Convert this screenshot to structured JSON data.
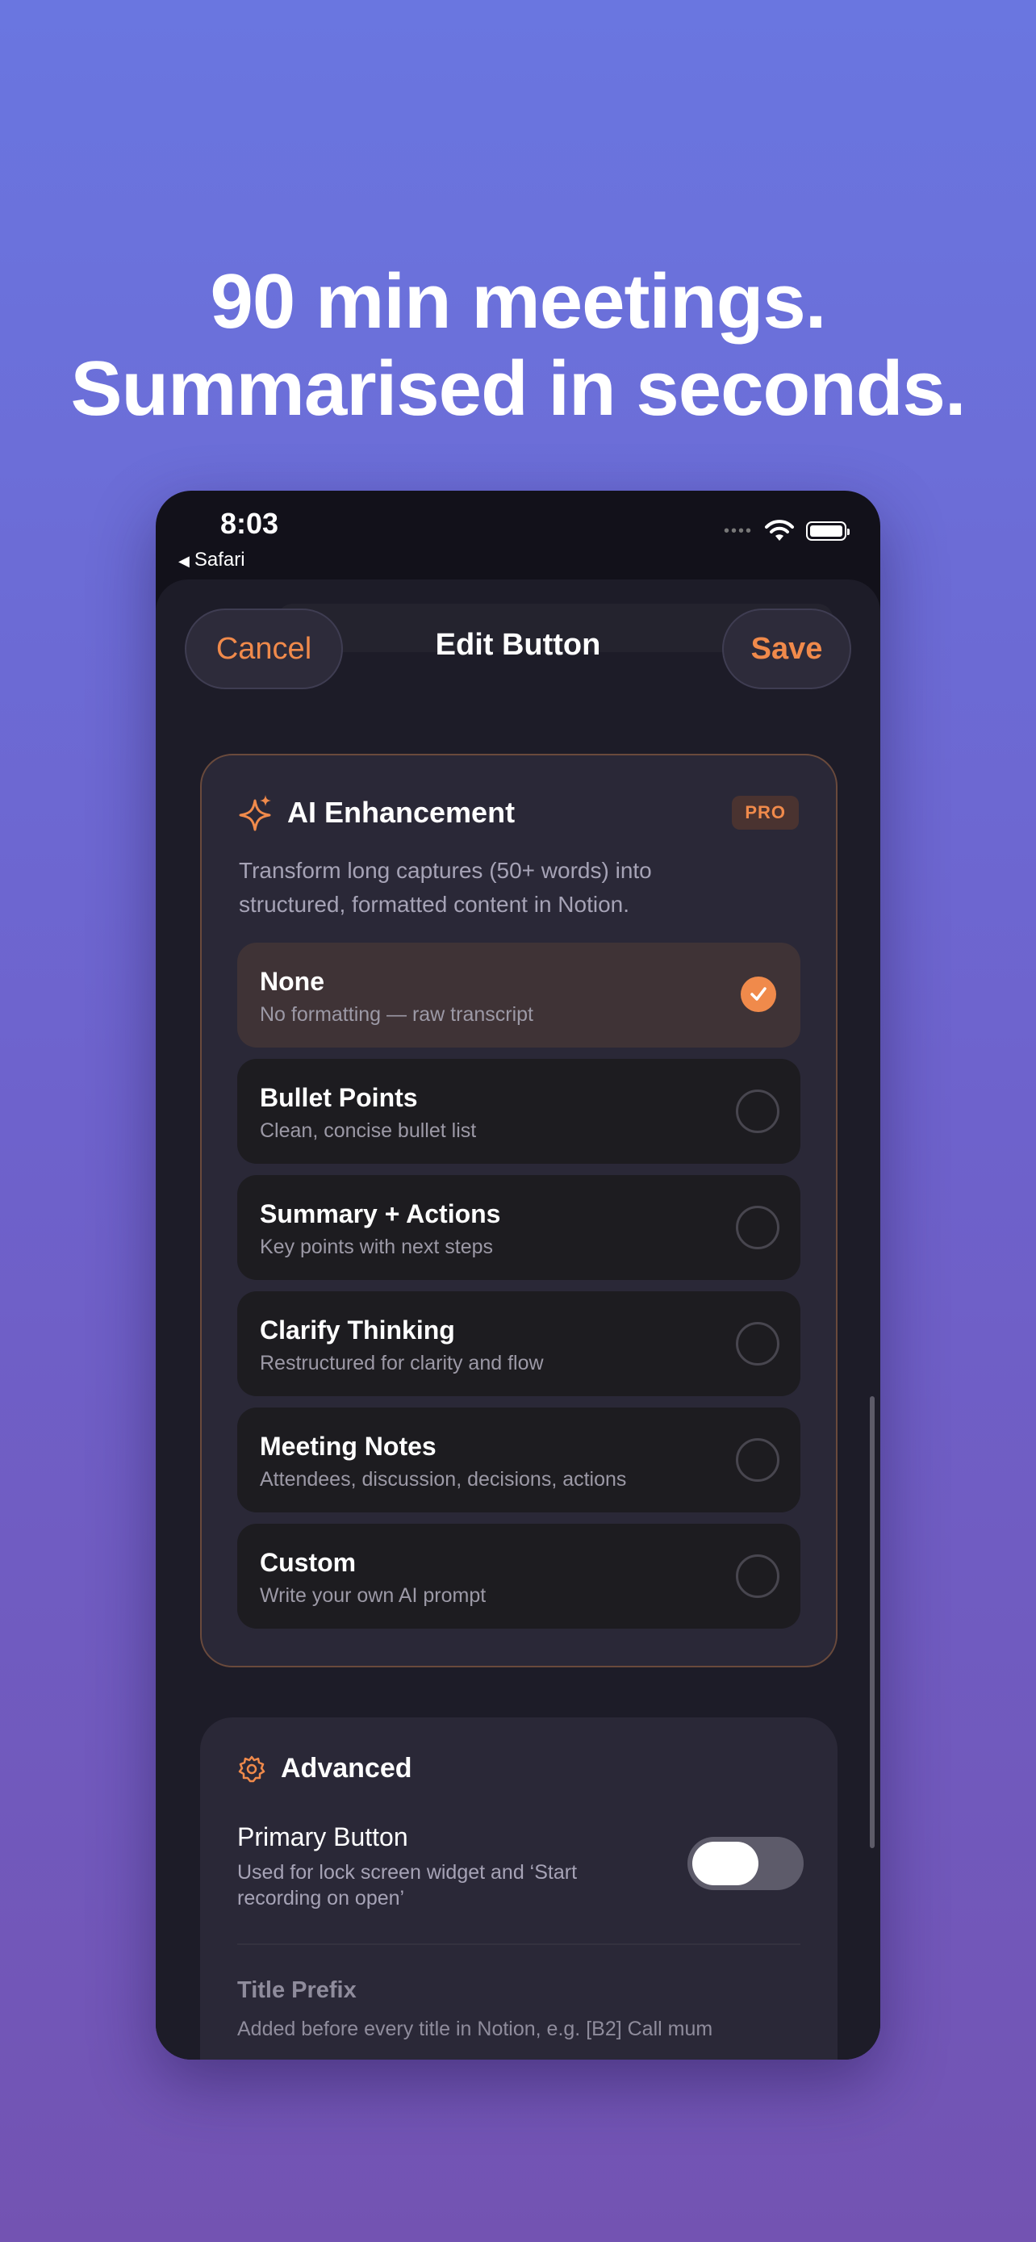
{
  "headline": {
    "line1": "90 min meetings.",
    "line2": "Summarised in seconds."
  },
  "statusbar": {
    "time": "8:03",
    "back_app": "Safari",
    "back_icon": "◀",
    "icons": [
      "cellular-dots-icon",
      "wifi-icon",
      "battery-icon"
    ]
  },
  "navbar": {
    "cancel_label": "Cancel",
    "title": "Edit Button",
    "save_label": "Save"
  },
  "ai_card": {
    "icon": "sparkles-icon",
    "title": "AI Enhancement",
    "badge": "PRO",
    "description": "Transform long captures (50+ words) into structured, formatted content in Notion.",
    "options": [
      {
        "title": "None",
        "subtitle": "No formatting — raw transcript",
        "selected": true
      },
      {
        "title": "Bullet Points",
        "subtitle": "Clean, concise bullet list",
        "selected": false
      },
      {
        "title": "Summary + Actions",
        "subtitle": "Key points with next steps",
        "selected": false
      },
      {
        "title": "Clarify Thinking",
        "subtitle": "Restructured for clarity and flow",
        "selected": false
      },
      {
        "title": "Meeting Notes",
        "subtitle": "Attendees, discussion, decisions, actions",
        "selected": false
      },
      {
        "title": "Custom",
        "subtitle": "Write your own AI prompt",
        "selected": false
      }
    ]
  },
  "advanced_card": {
    "icon": "gear-icon",
    "title": "Advanced",
    "primary_button_title": "Primary Button",
    "primary_button_subtitle": "Used for lock screen widget and ‘Start recording on open’",
    "primary_button_on": false,
    "title_prefix_label": "Title Prefix",
    "title_prefix_subtitle": "Added before every title in Notion, e.g. [B2] Call mum"
  },
  "colors": {
    "accent": "#f08a4b",
    "background_top": "#6a76e0",
    "background_bottom": "#7353b2",
    "sheet": "#1d1c28",
    "card": "#2a2837"
  }
}
